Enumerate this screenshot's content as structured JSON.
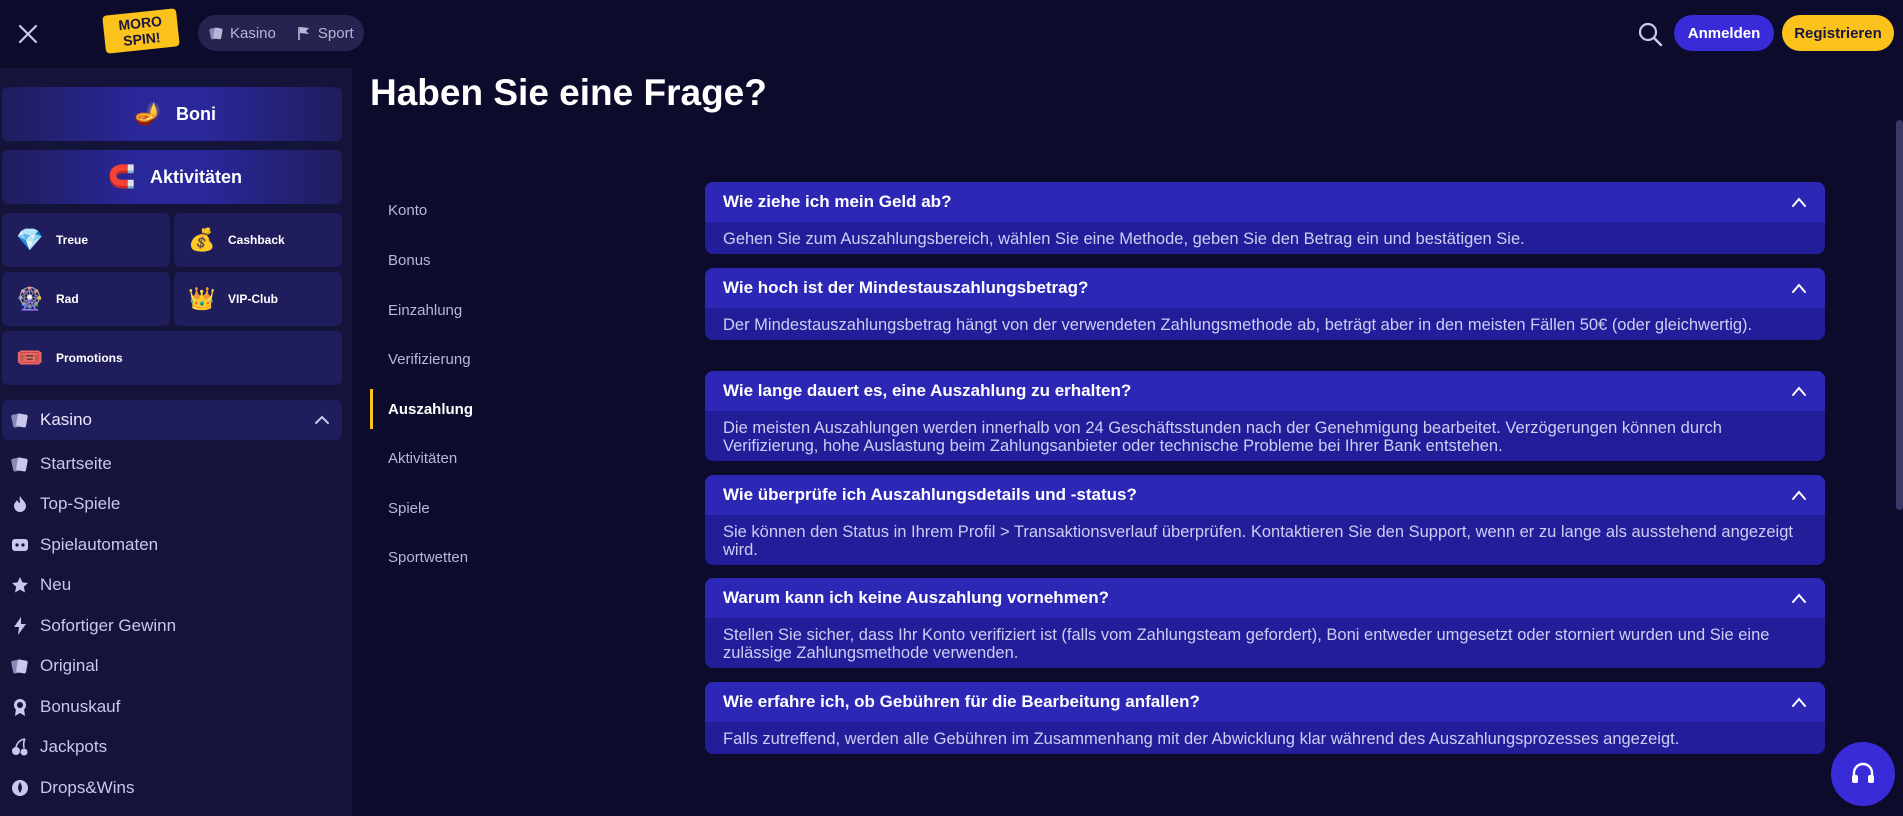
{
  "header": {
    "logo_text": "MORO SPIN!",
    "tabs": [
      {
        "label": "Kasino",
        "icon": "cards-icon"
      },
      {
        "label": "Sport",
        "icon": "flag-icon"
      }
    ],
    "login_label": "Anmelden",
    "register_label": "Registrieren"
  },
  "sidebar": {
    "promos_big": [
      {
        "label": "Boni",
        "icon": "genie-lamp-icon"
      },
      {
        "label": "Aktivitäten",
        "icon": "magnet-icon"
      }
    ],
    "promos_small": [
      {
        "label": "Treue",
        "icon": "gem-icon"
      },
      {
        "label": "Cashback",
        "icon": "money-bag-icon"
      },
      {
        "label": "Rad",
        "icon": "wheel-icon"
      },
      {
        "label": "VIP-Club",
        "icon": "vip-crown-icon"
      },
      {
        "label": "Promotions",
        "icon": "ticket-icon"
      }
    ],
    "category_header": "Kasino",
    "nav_items": [
      {
        "label": "Startseite",
        "icon": "cards-icon"
      },
      {
        "label": "Top-Spiele",
        "icon": "flame-icon"
      },
      {
        "label": "Spielautomaten",
        "icon": "slot-icon"
      },
      {
        "label": "Neu",
        "icon": "star-icon"
      },
      {
        "label": "Sofortiger Gewinn",
        "icon": "lightning-icon"
      },
      {
        "label": "Original",
        "icon": "cards-icon"
      },
      {
        "label": "Bonuskauf",
        "icon": "medal-icon"
      },
      {
        "label": "Jackpots",
        "icon": "cherry-icon"
      },
      {
        "label": "Drops&Wins",
        "icon": "drops-icon"
      }
    ]
  },
  "main": {
    "title": "Haben Sie eine Frage?",
    "categories": [
      "Konto",
      "Bonus",
      "Einzahlung",
      "Verifizierung",
      "Auszahlung",
      "Aktivitäten",
      "Spiele",
      "Sportwetten"
    ],
    "active_category": "Auszahlung",
    "faqs": [
      {
        "question": "Wie ziehe ich mein Geld ab?",
        "answer": "Gehen Sie zum Auszahlungsbereich, wählen Sie eine Methode, geben Sie den Betrag ein und bestätigen Sie."
      },
      {
        "question": "Wie hoch ist der Mindestauszahlungsbetrag?",
        "answer": "Der Mindestauszahlungsbetrag hängt von der verwendeten Zahlungsmethode ab, beträgt aber in den meisten Fällen 50€ (oder gleichwertig)."
      },
      {
        "question": "Wie lange dauert es, eine Auszahlung zu erhalten?",
        "answer": "Die meisten Auszahlungen werden innerhalb von 24 Geschäftsstunden nach der Genehmigung bearbeitet. Verzögerungen können durch Verifizierung, hohe Auslastung beim Zahlungsanbieter oder technische Probleme bei Ihrer Bank entstehen."
      },
      {
        "question": "Wie überprüfe ich Auszahlungsdetails und -status?",
        "answer": "Sie können den Status in Ihrem Profil > Transaktionsverlauf überprüfen. Kontaktieren Sie den Support, wenn er zu lange als ausstehend angezeigt wird."
      },
      {
        "question": "Warum kann ich keine Auszahlung vornehmen?",
        "answer": "Stellen Sie sicher, dass Ihr Konto verifiziert ist (falls vom Zahlungsteam gefordert), Boni entweder umgesetzt oder storniert wurden und Sie eine zulässige Zahlungsmethode verwenden."
      },
      {
        "question": "Wie erfahre ich, ob Gebühren für die Bearbeitung anfallen?",
        "answer": "Falls zutreffend, werden alle Gebühren im Zusammenhang mit der Abwicklung klar während des Auszahlungsprozesses angezeigt."
      }
    ]
  },
  "colors": {
    "background": "#0c0b2b",
    "sidebar": "#14133a",
    "accent": "#3a2bd8",
    "register": "#fbc21c",
    "faq_panel": "#221e9a"
  }
}
